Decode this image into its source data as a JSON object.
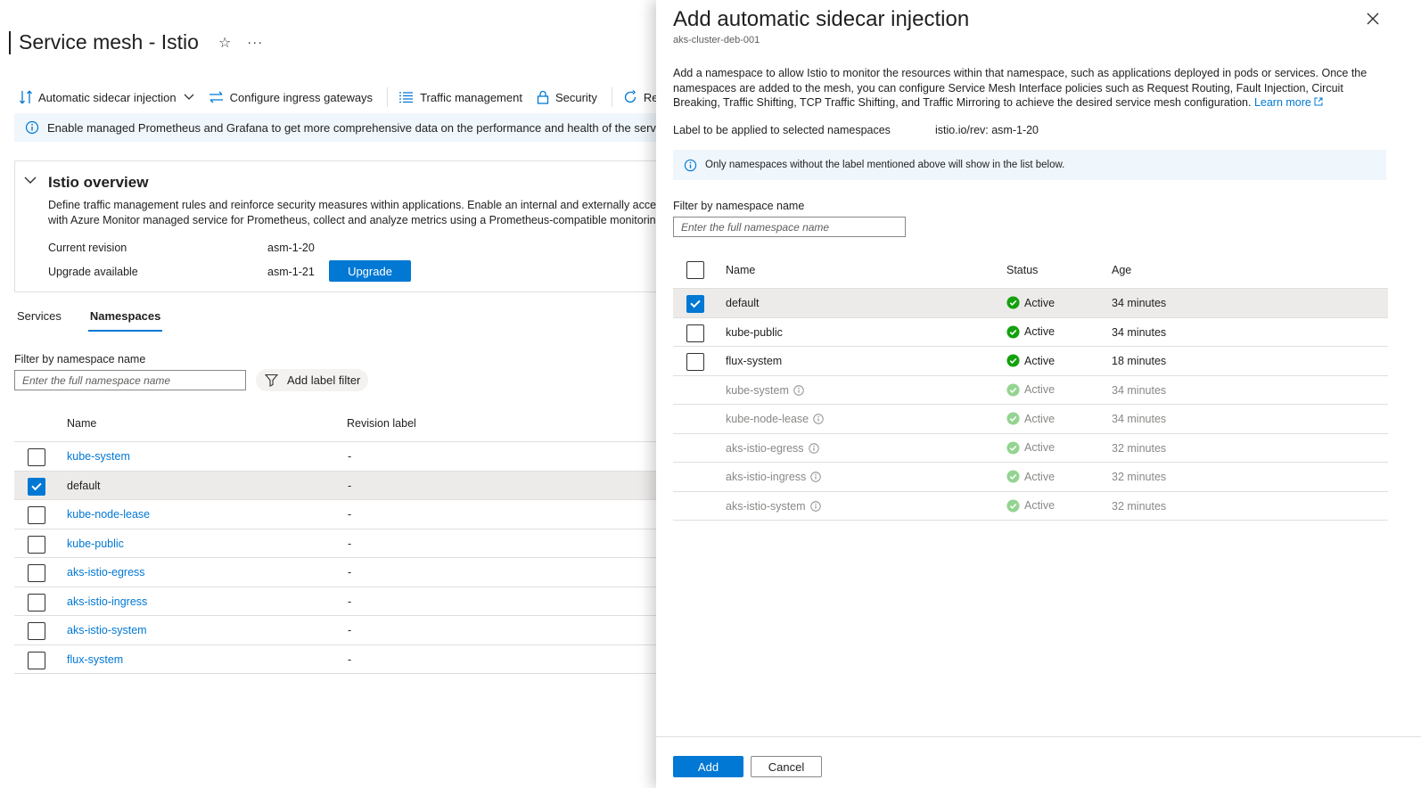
{
  "page": {
    "title": "Service mesh - Istio",
    "toolbar": [
      {
        "label": "Automatic sidecar injection",
        "icon": "sort-arrows-icon",
        "dropdown": true
      },
      {
        "label": "Configure ingress gateways",
        "icon": "swap-arrows-icon"
      },
      {
        "label": "Traffic management",
        "icon": "list-icon"
      },
      {
        "label": "Security",
        "icon": "lock-icon"
      },
      {
        "label": "Refresh",
        "icon": "refresh-icon"
      }
    ],
    "info_banner": "Enable managed Prometheus and Grafana to get more comprehensive data on the performance and health of the service mesh.",
    "overview": {
      "title": "Istio overview",
      "description_line1": "Define traffic management rules and reinforce security measures within applications. Enable an internal and externally accessible ingress gateway.",
      "description_line2": "with Azure Monitor managed service for Prometheus, collect and analyze metrics using a Prometheus-compatible monitoring solution.",
      "current_revision_label": "Current revision",
      "current_revision_value": "asm-1-20",
      "upgrade_label": "Upgrade available",
      "upgrade_value": "asm-1-21",
      "upgrade_button": "Upgrade"
    },
    "tabs": [
      "Services",
      "Namespaces"
    ],
    "active_tab": 1,
    "filter": {
      "label": "Filter by namespace name",
      "placeholder": "Enter the full namespace name",
      "add_label_filter": "Add label filter"
    },
    "table": {
      "col_name": "Name",
      "col_revision": "Revision label",
      "rows": [
        {
          "name": "kube-system",
          "revision": "-",
          "checked": false
        },
        {
          "name": "default",
          "revision": "-",
          "checked": true
        },
        {
          "name": "kube-node-lease",
          "revision": "-",
          "checked": false
        },
        {
          "name": "kube-public",
          "revision": "-",
          "checked": false
        },
        {
          "name": "aks-istio-egress",
          "revision": "-",
          "checked": false
        },
        {
          "name": "aks-istio-ingress",
          "revision": "-",
          "checked": false
        },
        {
          "name": "aks-istio-system",
          "revision": "-",
          "checked": false
        },
        {
          "name": "flux-system",
          "revision": "-",
          "checked": false
        }
      ]
    }
  },
  "panel": {
    "title": "Add automatic sidecar injection",
    "subtitle": "aks-cluster-deb-001",
    "description": "Add a namespace to allow Istio to monitor the resources within that namespace, such as applications deployed in pods or services. Once the namespaces are added to the mesh, you can configure Service Mesh Interface policies such as Request Routing, Fault Injection, Circuit Breaking, Traffic Shifting, TCP Traffic Shifting, and Traffic Mirroring to achieve the desired service mesh configuration.",
    "learn_more": "Learn more",
    "label_row_label": "Label to be applied to selected namespaces",
    "label_row_value": "istio.io/rev: asm-1-20",
    "info": "Only namespaces without the label mentioned above will show in the list below.",
    "filter_label": "Filter by namespace name",
    "filter_placeholder": "Enter the full namespace name",
    "table": {
      "col_name": "Name",
      "col_status": "Status",
      "col_age": "Age",
      "rows": [
        {
          "name": "default",
          "status": "Active",
          "age": "34 minutes",
          "checked": true,
          "disabled": false
        },
        {
          "name": "kube-public",
          "status": "Active",
          "age": "34 minutes",
          "checked": false,
          "disabled": false
        },
        {
          "name": "flux-system",
          "status": "Active",
          "age": "18 minutes",
          "checked": false,
          "disabled": false
        },
        {
          "name": "kube-system",
          "status": "Active",
          "age": "34 minutes",
          "checked": false,
          "disabled": true
        },
        {
          "name": "kube-node-lease",
          "status": "Active",
          "age": "34 minutes",
          "checked": false,
          "disabled": true
        },
        {
          "name": "aks-istio-egress",
          "status": "Active",
          "age": "32 minutes",
          "checked": false,
          "disabled": true
        },
        {
          "name": "aks-istio-ingress",
          "status": "Active",
          "age": "32 minutes",
          "checked": false,
          "disabled": true
        },
        {
          "name": "aks-istio-system",
          "status": "Active",
          "age": "32 minutes",
          "checked": false,
          "disabled": true
        }
      ]
    },
    "add_button": "Add",
    "cancel_button": "Cancel"
  },
  "colors": {
    "accent": "#0078d4",
    "success": "#13a10e",
    "info_bg": "#eff6fc",
    "selected_row": "#edebe9"
  }
}
